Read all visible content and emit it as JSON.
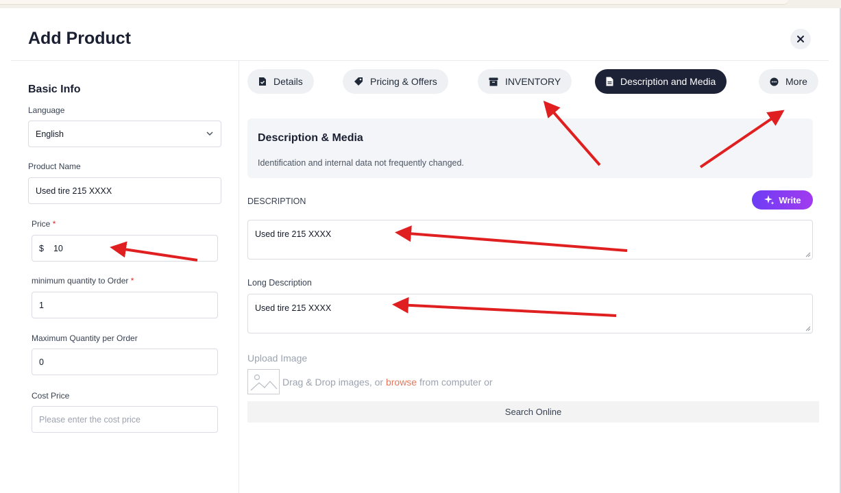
{
  "header": {
    "title": "Add Product",
    "close_icon": "close-icon"
  },
  "basic_info": {
    "title": "Basic Info",
    "language": {
      "label": "Language",
      "value": "English"
    },
    "product_name": {
      "label": "Product Name",
      "value": "Used tire 215 XXXX"
    },
    "price": {
      "label": "Price",
      "required_mark": "*",
      "currency": "$",
      "value": "10"
    },
    "min_qty": {
      "label": "minimum quantity to Order",
      "required_mark": "*",
      "value": "1"
    },
    "max_qty": {
      "label": "Maximum Quantity per Order",
      "value": "0"
    },
    "cost_price": {
      "label": "Cost Price",
      "placeholder": "Please enter the cost price"
    }
  },
  "tabs": [
    {
      "label": "Details",
      "icon": "file-check-icon"
    },
    {
      "label": "Pricing & Offers",
      "icon": "tag-icon"
    },
    {
      "label": "INVENTORY",
      "icon": "archive-box-icon"
    },
    {
      "label": "Description and Media",
      "icon": "document-icon",
      "active": true
    },
    {
      "label": "More",
      "icon": "more-dots-icon"
    }
  ],
  "section": {
    "title": "Description & Media",
    "subtitle": "Identification and internal data not frequently changed."
  },
  "description": {
    "label": "DESCRIPTION",
    "value": "Used tire 215 XXXX",
    "write_label": "Write"
  },
  "long_description": {
    "label": "Long Description",
    "value": "Used tire 215 XXXX"
  },
  "upload": {
    "label": "Upload Image",
    "drop_prefix": "Drag & Drop images, or",
    "browse": "browse",
    "drop_suffix": "from computer or",
    "search_online": "Search Online"
  },
  "colors": {
    "accent_dark": "#1d2237",
    "write_gradient_start": "#6d3df5",
    "write_gradient_end": "#a23bef",
    "annotation_arrow": "#e02020"
  }
}
